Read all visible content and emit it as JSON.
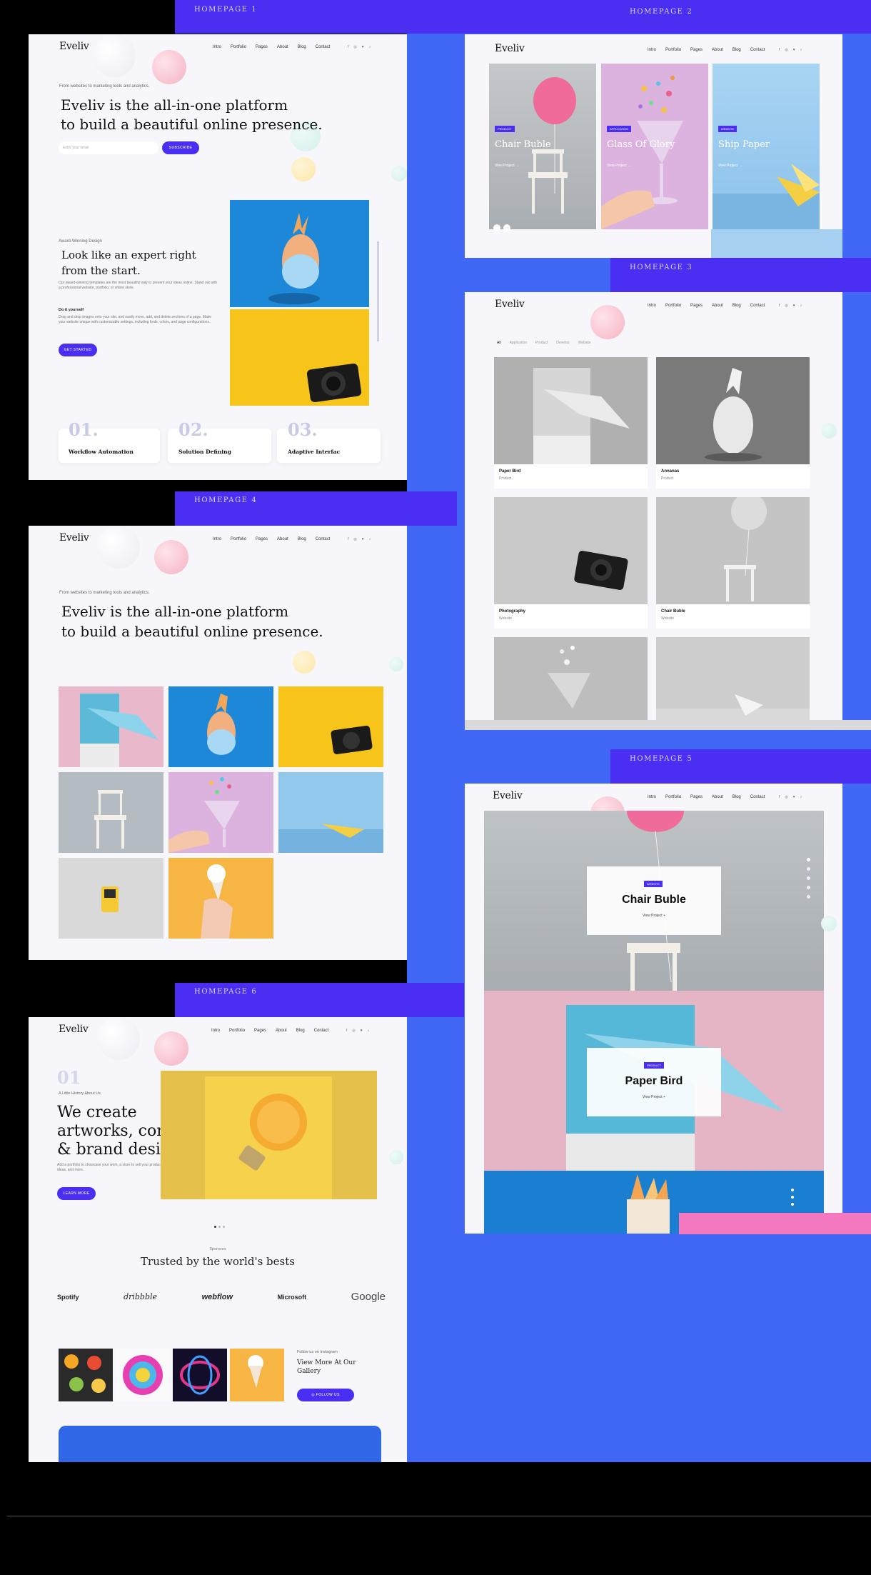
{
  "tabs": [
    "HOMEPAGE 1",
    "HOMEPAGE 2",
    "HOMEPAGE 3",
    "HOMEPAGE 4",
    "HOMEPAGE 5",
    "HOMEPAGE 6"
  ],
  "brand": "Eveliv",
  "nav_short": [
    "Intro",
    "Portfolio",
    "Pages",
    "About",
    "Blog",
    "Contact"
  ],
  "social": [
    "f",
    "◎",
    "♥",
    "♪"
  ],
  "hp1": {
    "tagline": "From websites to marketing tools and analytics.",
    "headline_1": "Eveliv is the all-in-one platform",
    "headline_2": "to build a beautiful online presence.",
    "email_placeholder": "Enter your email",
    "subscribe": "SUBSCRIBE",
    "award": "Award-Winning Design",
    "look_1": "Look like an expert right",
    "look_2": "from the start.",
    "look_body": "Our award-winning templates are the most beautiful way to present your ideas online. Stand out with a professional website, portfolio, or online store.",
    "diy": "Do it yourself",
    "diy_body": "Drag and drop images onto your site, and easily move, add, and delete sections of a page. Make your website unique with customizable settings, including fonts, colors, and page configurations.",
    "cta": "GET STARTED",
    "steps": [
      {
        "n": "01.",
        "t": "Workflow Automation"
      },
      {
        "n": "02.",
        "t": "Solution Defining"
      },
      {
        "n": "03.",
        "t": "Adaptive Interfac"
      }
    ]
  },
  "hp2": {
    "cards": [
      {
        "badge": "PRODUCT",
        "title": "Chair Buble",
        "link": "View Project  →",
        "color": "#b9bec2"
      },
      {
        "badge": "APPLICATION",
        "title": "Glass Of Glory",
        "link": "View Project  →",
        "color": "#d9b5dc"
      },
      {
        "badge": "WEBSITE",
        "title": "Ship Paper",
        "link": "View Project  →",
        "color": "#a8d0ef"
      }
    ]
  },
  "hp3": {
    "filters": [
      "All",
      "Application",
      "Product",
      "Develop",
      "Website"
    ],
    "items": [
      {
        "title": "Paper Bird",
        "cat": "Product"
      },
      {
        "title": "Annanas",
        "cat": "Product"
      },
      {
        "title": "Photography",
        "cat": "Website"
      },
      {
        "title": "Chair Buble",
        "cat": "Website"
      }
    ]
  },
  "hp5": {
    "slides": [
      {
        "badge": "WEBSITE",
        "title": "Chair Buble",
        "link": "View Project  +"
      },
      {
        "badge": "PRODUCT",
        "title": "Paper Bird",
        "link": "View Project  +"
      }
    ]
  },
  "hp6": {
    "num": "01",
    "small": "A Little History About Us",
    "h1": "We create",
    "h2": "artworks, concepts,",
    "h3": "& brand design",
    "body": "Add a portfolio to showcase your work, a store to sell your products or services, a blog to share your ideas, and more.",
    "cta": "LEARN MORE",
    "sponsors_label": "Sponsors",
    "trusted": "Trusted by the world's bests",
    "logos": [
      "Spotify",
      "dribbble",
      "webflow",
      "Microsoft",
      "Google"
    ],
    "insta_label": "Follow us on Instagram",
    "insta_title_1": "View More At Our",
    "insta_title_2": "Gallery",
    "follow": "FOLLOW US"
  },
  "colors": {
    "accent": "#4a2ef2",
    "blue_bg": "#4067f5"
  }
}
